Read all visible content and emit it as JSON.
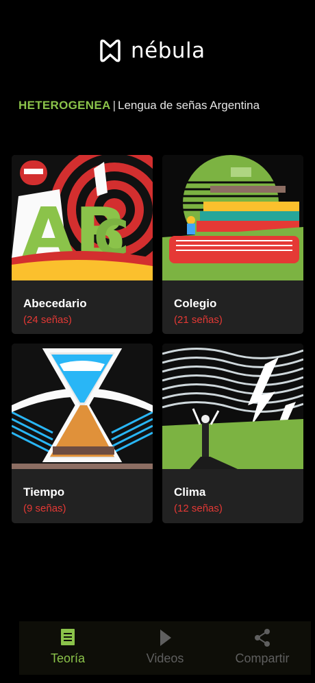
{
  "app": {
    "logo_text": "nébula"
  },
  "header": {
    "brand": "HETEROGENEA",
    "separator": "|",
    "subtitle": "Lengua de señas Argentina"
  },
  "cards": [
    {
      "title": "Abecedario",
      "count": "(24 señas)"
    },
    {
      "title": "Colegio",
      "count": "(21 señas)"
    },
    {
      "title": "Tiempo",
      "count": "(9 señas)"
    },
    {
      "title": "Clima",
      "count": "(12 señas)"
    }
  ],
  "nav": [
    {
      "label": "Teoría",
      "icon": "document-icon",
      "active": true
    },
    {
      "label": "Videos",
      "icon": "play-icon",
      "active": false
    },
    {
      "label": "Compartir",
      "icon": "share-icon",
      "active": false
    }
  ],
  "colors": {
    "accent": "#8bc34a",
    "count_red": "#e53935",
    "card_bg": "#222222"
  }
}
